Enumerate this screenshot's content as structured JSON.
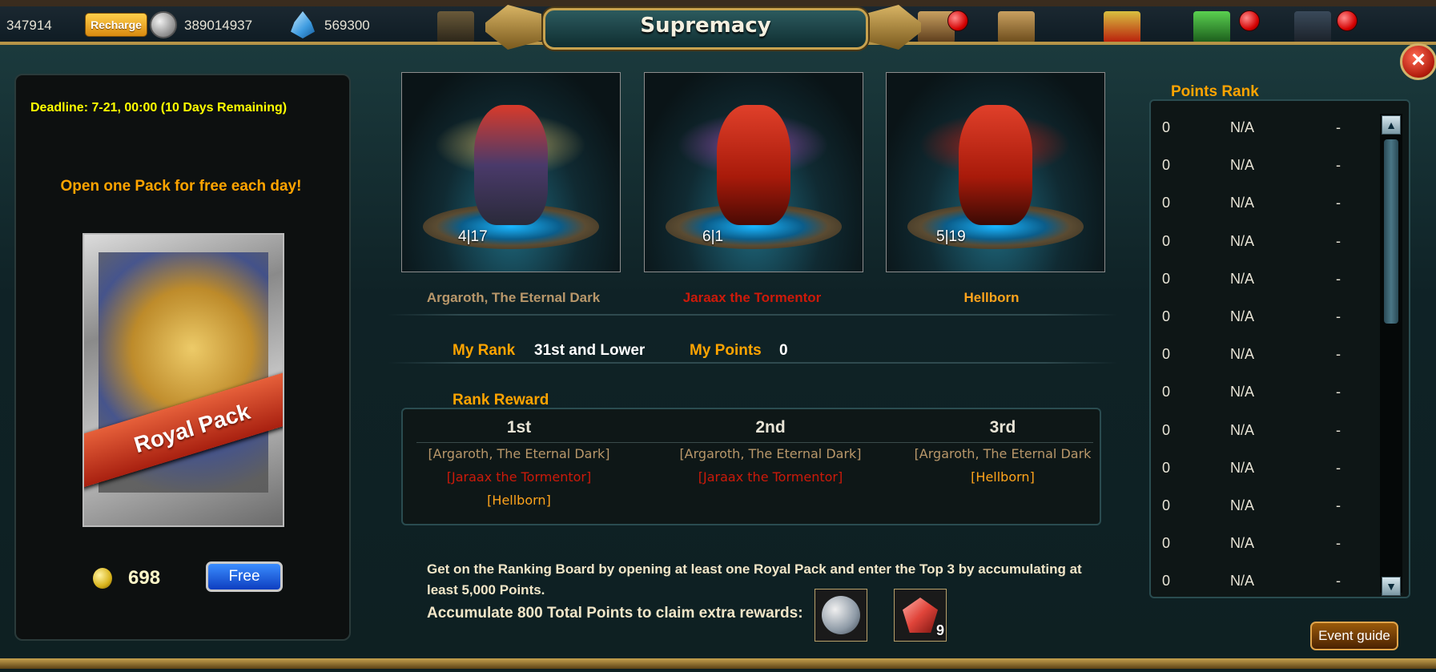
{
  "header": {
    "resource_1": "347914",
    "recharge_label": "Recharge",
    "silver": "389014937",
    "crystals": "569300",
    "title": "Supremacy"
  },
  "left": {
    "deadline": "Deadline: 7-21, 00:00 (10 Days Remaining)",
    "promo": "Open one Pack for free each day!",
    "pack_label": "Royal Pack",
    "cost": "698",
    "free_label": "Free"
  },
  "bosses": [
    {
      "count": "4|17",
      "name": "Argaroth, The Eternal Dark",
      "color": "#b8976a"
    },
    {
      "count": "6|1",
      "name": "Jaraax the Tormentor",
      "color": "#cc1a0a"
    },
    {
      "count": "5|19",
      "name": "Hellborn",
      "color": "#ffa41c"
    }
  ],
  "my_rank": {
    "rank_label": "My Rank",
    "rank_value": "31st and Lower",
    "points_label": "My Points",
    "points_value": "0"
  },
  "rank_reward": {
    "title": "Rank Reward",
    "columns": [
      {
        "place": "1st",
        "items": [
          "[Argaroth, The Eternal Dark]",
          "[Jaraax the Tormentor]",
          "[Hellborn]"
        ]
      },
      {
        "place": "2nd",
        "items": [
          "[Argaroth, The Eternal Dark]",
          "[Jaraax the Tormentor]"
        ]
      },
      {
        "place": "3rd",
        "items": [
          "[Argaroth, The Eternal Dark",
          "[Hellborn]"
        ]
      }
    ]
  },
  "info": {
    "line1": "Get on the Ranking Board by opening at least one Royal Pack and enter the Top 3 by accumulating at least 5,000 Points.",
    "line2": "Accumulate 800 Total Points to claim extra rewards:",
    "reward_qty": "9"
  },
  "points_rank": {
    "title": "Points Rank",
    "rows": [
      {
        "rank": "0",
        "name": "N/A",
        "points": "-"
      },
      {
        "rank": "0",
        "name": "N/A",
        "points": "-"
      },
      {
        "rank": "0",
        "name": "N/A",
        "points": "-"
      },
      {
        "rank": "0",
        "name": "N/A",
        "points": "-"
      },
      {
        "rank": "0",
        "name": "N/A",
        "points": "-"
      },
      {
        "rank": "0",
        "name": "N/A",
        "points": "-"
      },
      {
        "rank": "0",
        "name": "N/A",
        "points": "-"
      },
      {
        "rank": "0",
        "name": "N/A",
        "points": "-"
      },
      {
        "rank": "0",
        "name": "N/A",
        "points": "-"
      },
      {
        "rank": "0",
        "name": "N/A",
        "points": "-"
      },
      {
        "rank": "0",
        "name": "N/A",
        "points": "-"
      },
      {
        "rank": "0",
        "name": "N/A",
        "points": "-"
      },
      {
        "rank": "0",
        "name": "N/A",
        "points": "-"
      }
    ]
  },
  "event_guide_label": "Event guide",
  "icons": [
    "silver-coin-icon",
    "crystal-icon",
    "close-icon",
    "gold-coin-icon",
    "scroll-up-icon",
    "scroll-down-icon",
    "silver-medal-icon",
    "red-gem-icon",
    "notification-dot-icon"
  ],
  "colors": {
    "accent_orange": "#ffa400",
    "deadline_yellow": "#ffff00",
    "free_blue": "#1a5ad8"
  }
}
